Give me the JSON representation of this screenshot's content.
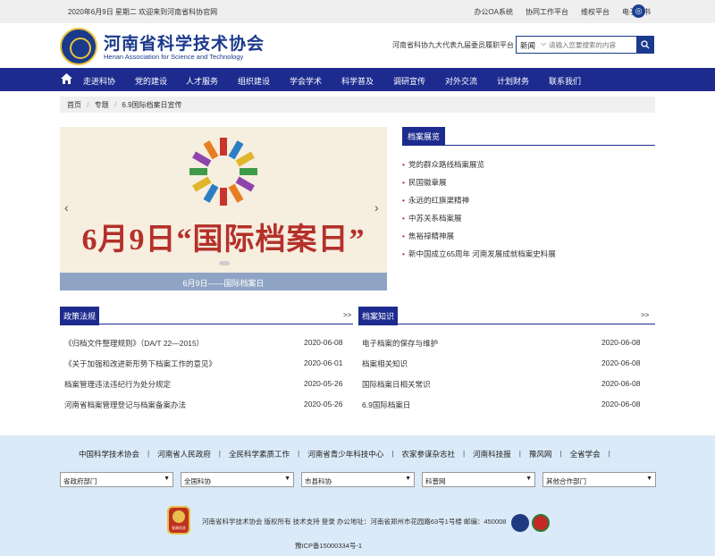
{
  "topbar": {
    "date_welcome": "2020年6月9日 星期二 欢迎来到河南省科协官网",
    "links": [
      "办公OA系统",
      "协同工作平台",
      "维权平台",
      "电子图书"
    ],
    "weibo_icon": "weibo-icon"
  },
  "header": {
    "title": "河南省科学技术协会",
    "subtitle": "Henan Association for Science and Technology",
    "tagline": "河南省科协九大代表九届委员履职平台",
    "search": {
      "category": "新闻",
      "placeholder": "请输入您要搜索的内容"
    }
  },
  "nav": {
    "items": [
      "走进科协",
      "党的建设",
      "人才服务",
      "组织建设",
      "学会学术",
      "科学普及",
      "调研宣传",
      "对外交流",
      "计划财务",
      "联系我们"
    ]
  },
  "breadcrumb": [
    "首页",
    "专题",
    "6.9国际档案日宣传"
  ],
  "slider": {
    "headline": "6月9日“国际档案日”",
    "caption": "6月9日——国际档案日"
  },
  "exhibit": {
    "tab": "档案展览",
    "items": [
      "党的群众路线档案展览",
      "民国徽章展",
      "永远的红旗渠精神",
      "中苏关系档案展",
      "焦裕禄精神展",
      "新中国成立65周年 河南发展成就档案史料展"
    ]
  },
  "policy": {
    "tab": "政策法规",
    "more": ">>",
    "rows": [
      {
        "title": "《归档文件整理规则》（DA/T 22—2015）",
        "date": "2020-06-08"
      },
      {
        "title": "《关于加强和改进新形势下档案工作的意见》",
        "date": "2020-06-01"
      },
      {
        "title": "档案管理违法违纪行为处分规定",
        "date": "2020-05-26"
      },
      {
        "title": "河南省档案管理登记与档案备案办法",
        "date": "2020-05-26"
      }
    ]
  },
  "knowledge": {
    "tab": "档案知识",
    "more": ">>",
    "rows": [
      {
        "title": "电子档案的保存与维护",
        "date": "2020-06-08"
      },
      {
        "title": "档案相关知识",
        "date": "2020-06-08"
      },
      {
        "title": "国际档案日相关常识",
        "date": "2020-06-08"
      },
      {
        "title": "6.9国际档案日",
        "date": "2020-06-08"
      }
    ]
  },
  "footer": {
    "links": [
      "中国科学技术协会",
      "河南省人民政府",
      "全民科学素质工作",
      "河南省青少年科技中心",
      "农家参谋杂志社",
      "河南科技报",
      "豫风网",
      "全省学会"
    ],
    "selects": [
      "省政府部门",
      "全国科协",
      "市县科协",
      "科普网",
      "其他合作部门"
    ],
    "copyright": "河南省科学技术协会 版权所有 技术支持 登录 办公地址：河南省郑州市花园路63号1号楼 邮编：450008",
    "icp": "豫ICP备15000334号-1",
    "badge_text": "党政机关"
  }
}
